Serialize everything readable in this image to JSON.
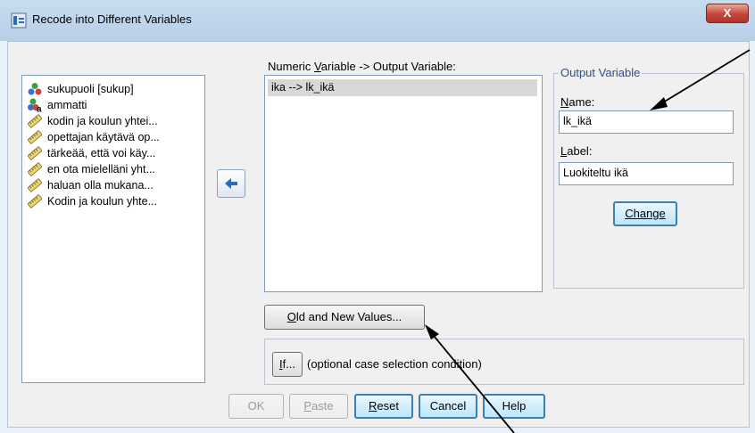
{
  "window": {
    "title": "Recode into Different Variables",
    "close_label": "X"
  },
  "source_variables": [
    {
      "label": "sukupuoli [sukup]",
      "icon": "nominal-variable-icon"
    },
    {
      "label": "ammatti",
      "icon": "nominal-string-variable-icon"
    },
    {
      "label": "kodin ja koulun yhtei...",
      "icon": "scale-variable-icon"
    },
    {
      "label": "opettajan käytävä op...",
      "icon": "scale-variable-icon"
    },
    {
      "label": "tärkeää, että voi käy...",
      "icon": "scale-variable-icon"
    },
    {
      "label": "en ota mielelläni yht...",
      "icon": "scale-variable-icon"
    },
    {
      "label": "haluan olla mukana...",
      "icon": "scale-variable-icon"
    },
    {
      "label": "Kodin ja koulun yhte...",
      "icon": "scale-variable-icon"
    }
  ],
  "numeric_list": {
    "label_pre": "Numeric ",
    "label_key": "V",
    "label_post": "ariable -> Output Variable:",
    "items": [
      "ika --> lk_ikä"
    ]
  },
  "output_variable": {
    "legend": "Output Variable",
    "name_label_key": "N",
    "name_label_rest": "ame:",
    "name_value": "lk_ikä",
    "label_label_key": "L",
    "label_label_rest": "abel:",
    "label_value": "Luokiteltu ikä",
    "change_button": "Change"
  },
  "buttons": {
    "old_new_key": "O",
    "old_new_rest": "ld and New Values...",
    "if_key": "I",
    "if_rest": "f...",
    "if_caption": "(optional case selection condition)",
    "ok": "OK",
    "paste_key": "P",
    "paste_rest": "aste",
    "reset_key": "R",
    "reset_rest": "eset",
    "cancel": "Cancel",
    "help": "Help"
  },
  "colors": {
    "annotation_arrow": "#000000",
    "focus_border": "#3c7fb1",
    "close_button": "#c4443a"
  }
}
